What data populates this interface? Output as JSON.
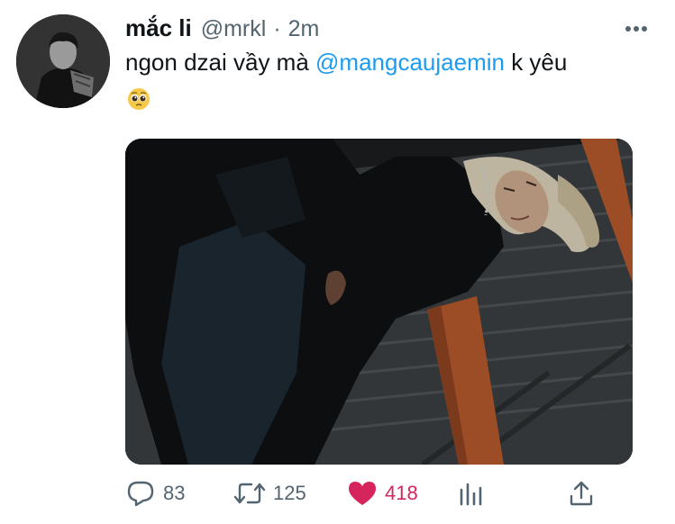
{
  "tweet": {
    "display_name": "mắc li",
    "handle": "@mrkl",
    "separator": "·",
    "time": "2m",
    "text_before": "ngon dzai vầy mà ",
    "mention": "@mangcaujaemin",
    "text_after": " k yêu",
    "emoji": "pleading-face"
  },
  "actions": {
    "reply_count": "83",
    "retweet_count": "125",
    "like_count": "418",
    "liked": true
  },
  "colors": {
    "mention": "#1d9bf0",
    "like": "#d6245c",
    "secondary_text": "#536471",
    "primary_text": "#0f1419"
  },
  "icons": [
    "more-icon",
    "reply-icon",
    "retweet-icon",
    "heart-icon",
    "analytics-icon",
    "share-icon",
    "pleading-face-emoji"
  ]
}
